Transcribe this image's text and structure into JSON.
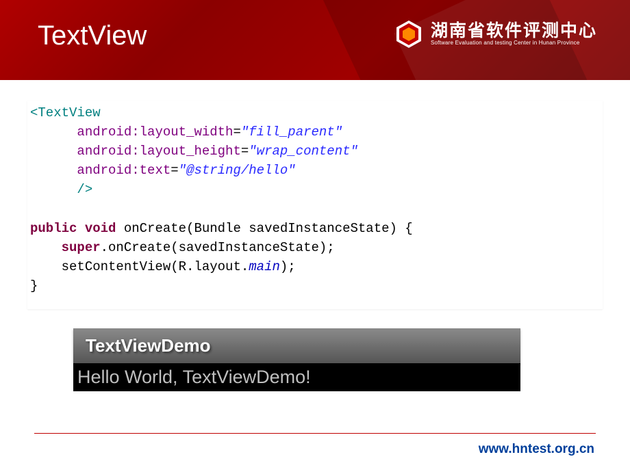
{
  "header": {
    "title": "TextView",
    "org_name": "湖南省软件评测中心",
    "org_sub": "Software Evaluation and testing Center in Hunan Province"
  },
  "xml": {
    "tag_open": "<TextView",
    "attr1_name": "android:layout_width",
    "attr1_val": "\"fill_parent\"",
    "attr2_name": "android:layout_height",
    "attr2_val": "\"wrap_content\"",
    "attr3_name": "android:text",
    "attr3_val": "\"@string/hello\"",
    "tag_close": "/>"
  },
  "java": {
    "kw_pub": "public",
    "kw_void": "void",
    "sig_rest": " onCreate(Bundle savedInstanceState) {",
    "kw_super": "super",
    "line2_rest": ".onCreate(savedInstanceState);",
    "line3_pre": "setContentView(R.layout.",
    "line3_id": "main",
    "line3_post": ");",
    "close": "}"
  },
  "demo": {
    "title": "TextViewDemo",
    "body": "Hello World, TextViewDemo!"
  },
  "footer": {
    "url": "www.hntest.org.cn"
  }
}
